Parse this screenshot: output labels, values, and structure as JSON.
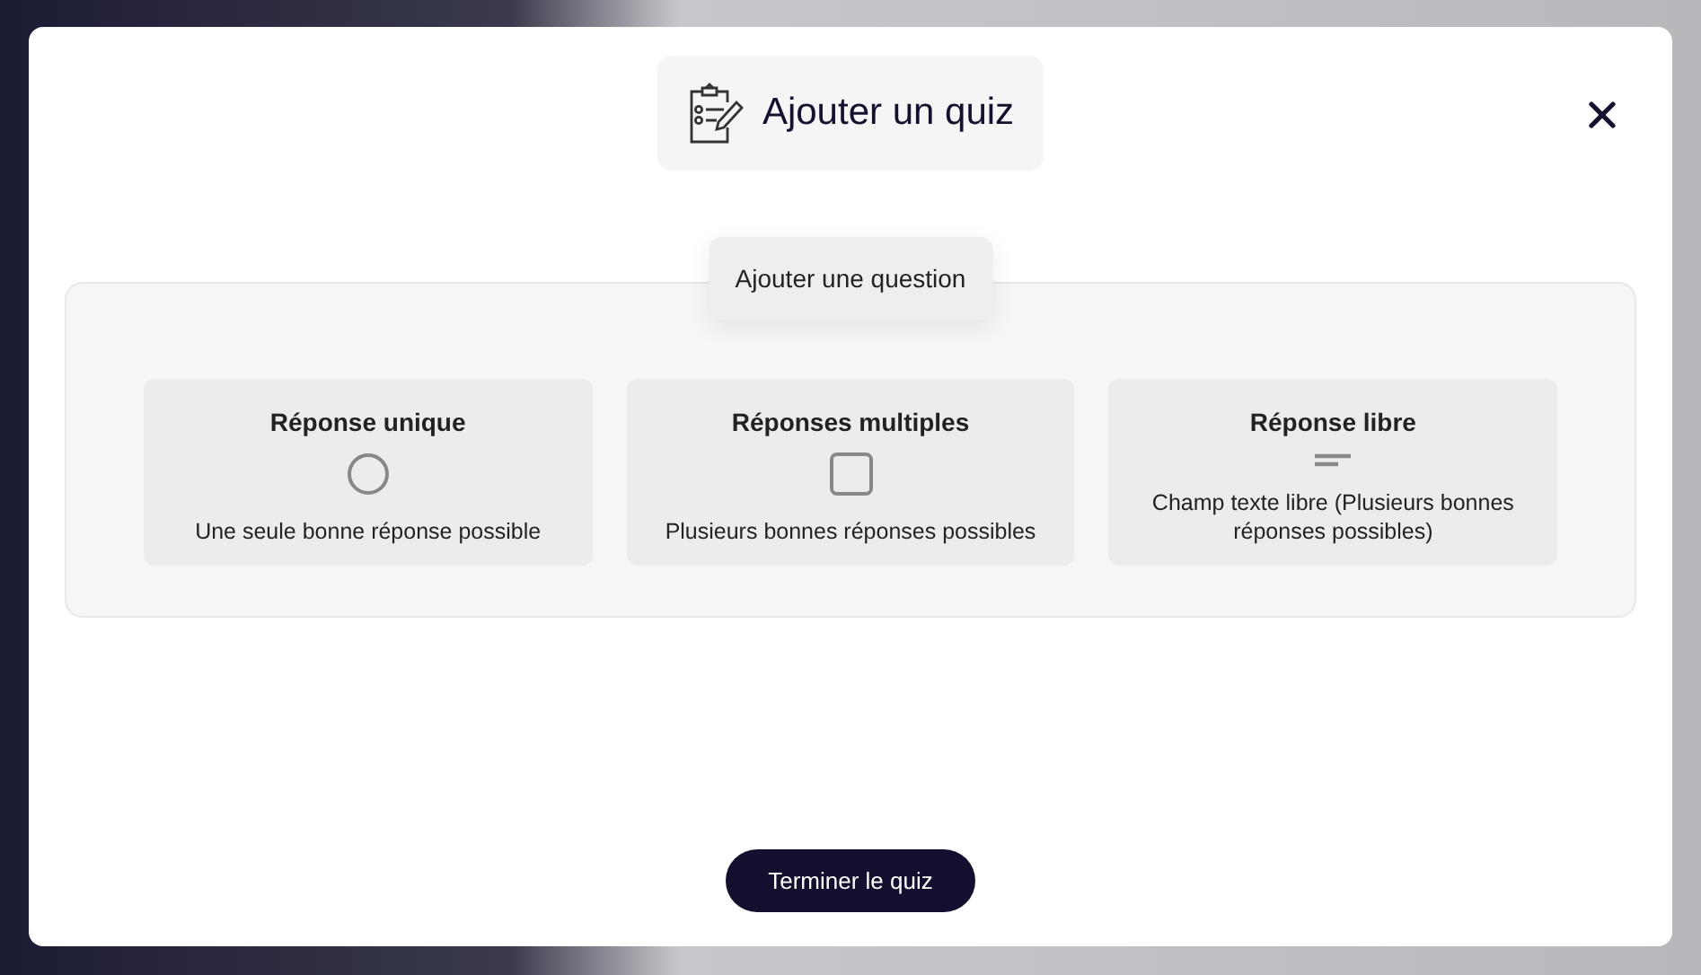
{
  "dialog": {
    "title": "Ajouter un quiz"
  },
  "section": {
    "label": "Ajouter une question"
  },
  "options": [
    {
      "kind": "radio",
      "title": "Réponse unique",
      "description": "Une seule bonne réponse possible"
    },
    {
      "kind": "checkbox",
      "title": "Réponses multiples",
      "description": "Plusieurs bonnes réponses possibles"
    },
    {
      "kind": "text",
      "title": "Réponse libre",
      "description": "Champ texte libre (Plusieurs bonnes réponses possibles)"
    }
  ],
  "finish_button": "Terminer le quiz"
}
